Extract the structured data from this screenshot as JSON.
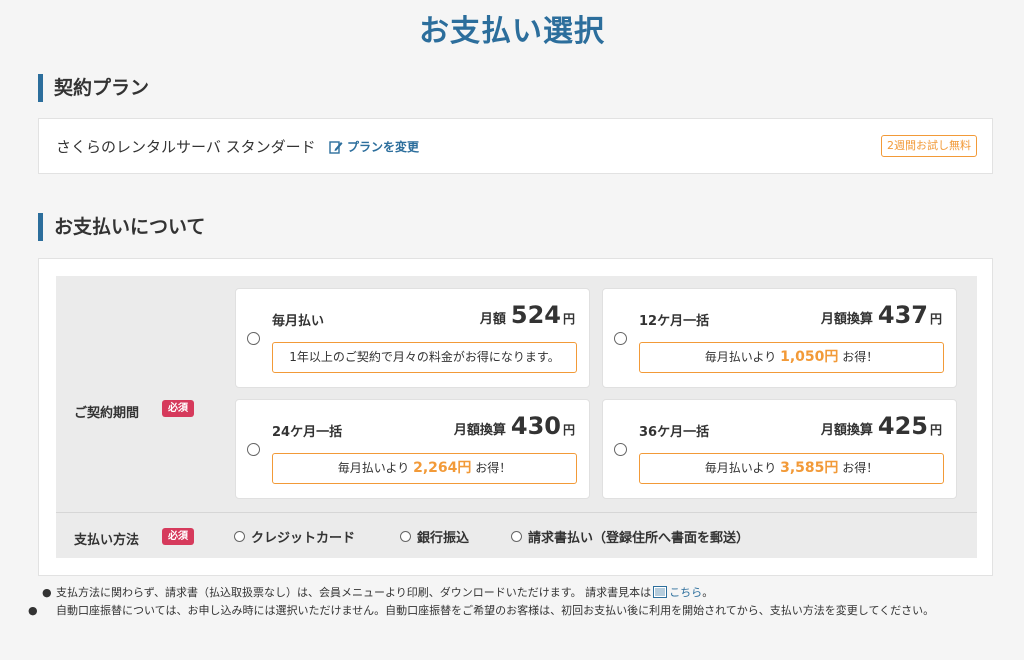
{
  "page": {
    "title": "お支払い選択"
  },
  "contract": {
    "heading": "契約プラン",
    "plan_name": "さくらのレンタルサーバ スタンダード",
    "change_label": "プランを変更",
    "trial_badge": "2週間お試し無料"
  },
  "payment": {
    "heading": "お支払いについて",
    "period_label": "ご契約期間",
    "required_badge": "必須",
    "options": [
      {
        "title": "毎月払い",
        "price_label": "月額",
        "price": "524",
        "unit": "円",
        "note_text": "1年以上のご契約で月々の料金がお得になります。",
        "note_prefix": "",
        "note_amount": "",
        "note_suffix": ""
      },
      {
        "title": "12ケ月一括",
        "price_label": "月額換算",
        "price": "437",
        "unit": "円",
        "note_text": "",
        "note_prefix": "毎月払いより",
        "note_amount": "1,050円",
        "note_suffix": "お得！"
      },
      {
        "title": "24ケ月一括",
        "price_label": "月額換算",
        "price": "430",
        "unit": "円",
        "note_text": "",
        "note_prefix": "毎月払いより",
        "note_amount": "2,264円",
        "note_suffix": "お得！"
      },
      {
        "title": "36ケ月一括",
        "price_label": "月額換算",
        "price": "425",
        "unit": "円",
        "note_text": "",
        "note_prefix": "毎月払いより",
        "note_amount": "3,585円",
        "note_suffix": "お得！"
      }
    ],
    "method_label": "支払い方法",
    "methods": [
      "クレジットカード",
      "銀行振込",
      "請求書払い（登録住所へ書面を郵送）"
    ]
  },
  "notes": {
    "line1_text": "支払方法に関わらず、請求書（払込取扱票なし）は、会員メニューより印刷、ダウンロードいただけます。 請求書見本は",
    "line1_link": "こちら",
    "line1_end": "。",
    "line2_text": "自動口座振替については、お申し込み時には選択いただけません。自動口座振替をご希望のお客様は、初回お支払い後に利用を開始されてから、支払い方法を変更してください。"
  },
  "colors": {
    "brand_blue": "#2c6e9c",
    "accent_orange": "#f29a38",
    "required_red": "#d63a5c"
  },
  "icons": {
    "change_plan": "edit-icon",
    "sample_doc": "document-icon",
    "bullet": "bullet-icon"
  }
}
